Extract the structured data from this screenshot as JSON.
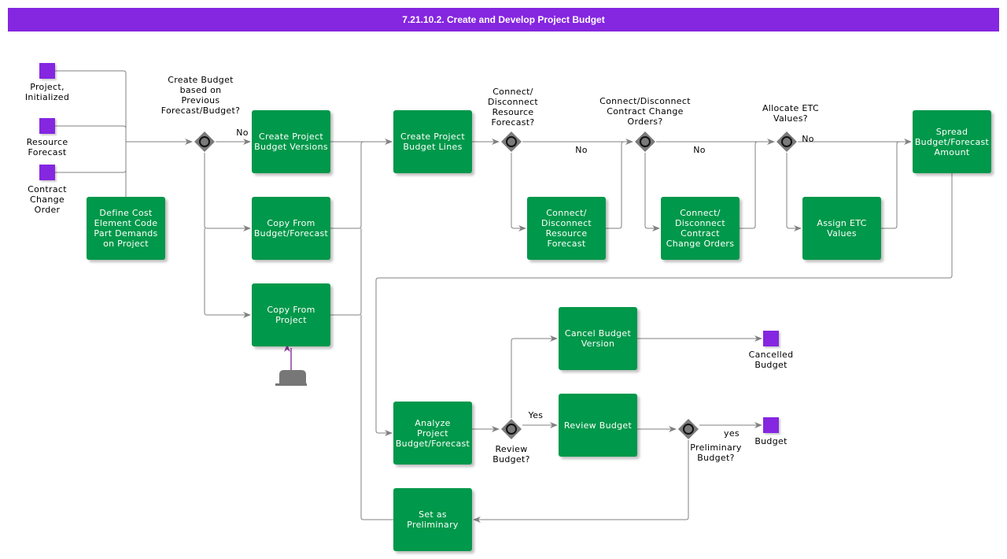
{
  "header": {
    "title": "7.21.10.2. Create and Develop Project Budget"
  },
  "colors": {
    "header": "#8526e0",
    "task": "#00984a",
    "event": "#8526e0",
    "gateway": "#7a7a7a",
    "connector": "#808080",
    "data_link": "#8b3d9c"
  },
  "events": {
    "project_initialized": "Project,\nInitialized",
    "resource_forecast": "Resource\nForecast",
    "contract_change_order": "Contract\nChange\nOrder",
    "cancelled_budget": "Cancelled\nBudget",
    "budget": "Budget"
  },
  "tasks": {
    "define_cost": "Define Cost\nElement Code\nPart Demands\non Project",
    "create_versions": "Create Project\nBudget Versions",
    "copy_budget": "Copy From\nBudget/Forecast",
    "copy_project": "Copy From\nProject",
    "create_lines": "Create Project\nBudget Lines",
    "connect_resource": "Connect/\nDisconnect\nResource\nForecast",
    "connect_contract": "Connect/\nDisconnect\nContract\nChange Orders",
    "assign_etc": "Assign ETC\nValues",
    "spread": "Spread\nBudget/Forecast\nAmount",
    "analyze": "Analyze\nProject\nBudget/Forecast",
    "cancel_version": "Cancel Budget\nVersion",
    "review_budget": "Review Budget",
    "set_preliminary": "Set as\nPreliminary"
  },
  "gateways": {
    "create_based_on_previous": "Create Budget\nbased on\nPrevious\nForecast/Budget?",
    "connect_resource_q": "Connect/\nDisconnect\nResource\nForecast?",
    "connect_contract_q": "Connect/Disconnect\nContract Change\nOrders?",
    "allocate_etc_q": "Allocate ETC\nValues?",
    "review_budget_q": "Review\nBudget?",
    "preliminary_q": "Preliminary\nBudget?"
  },
  "flow_labels": {
    "no_1": "No",
    "no_2": "No",
    "no_3": "No",
    "no_4": "No",
    "yes_review": "Yes",
    "yes_preliminary": "yes"
  }
}
